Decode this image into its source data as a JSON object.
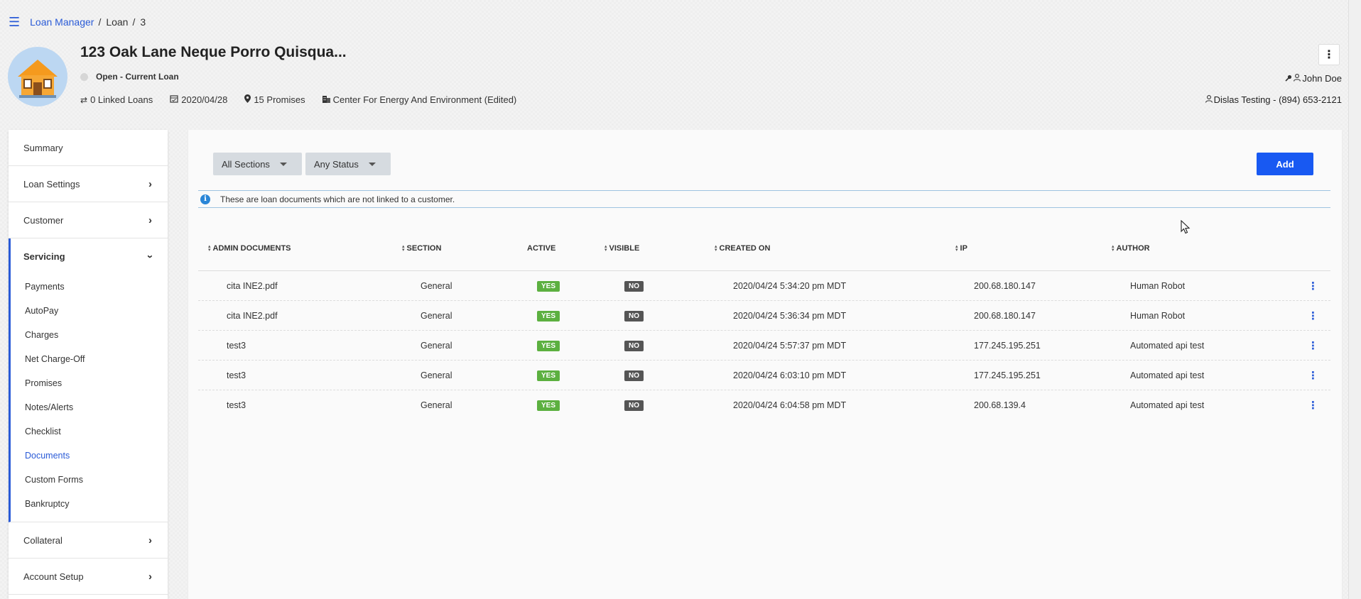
{
  "breadcrumb": {
    "root": "Loan Manager",
    "section": "Loan",
    "id": "3"
  },
  "loan": {
    "title": "123 Oak Lane Neque Porro Quisqua...",
    "status": "Open - Current Loan",
    "linked_loans": "0 Linked Loans",
    "date": "2020/04/28",
    "promises": "15 Promises",
    "company": "Center For Energy And Environment (Edited)",
    "owner": "John Doe",
    "contact": "Dislas Testing - (894) 653-2121"
  },
  "sidebar": {
    "sections": [
      {
        "label": "Summary"
      },
      {
        "label": "Loan Settings"
      },
      {
        "label": "Customer"
      }
    ],
    "servicing": {
      "label": "Servicing",
      "items": [
        {
          "label": "Payments"
        },
        {
          "label": "AutoPay"
        },
        {
          "label": "Charges"
        },
        {
          "label": "Net Charge-Off"
        },
        {
          "label": "Promises"
        },
        {
          "label": "Notes/Alerts"
        },
        {
          "label": "Checklist"
        },
        {
          "label": "Documents"
        },
        {
          "label": "Custom Forms"
        },
        {
          "label": "Bankruptcy"
        }
      ]
    },
    "after": [
      {
        "label": "Collateral"
      },
      {
        "label": "Account Setup"
      }
    ]
  },
  "filters": {
    "section": "All Sections",
    "status": "Any Status"
  },
  "add_label": "Add",
  "info_text": "These are loan documents which are not linked to a customer.",
  "table": {
    "headers": {
      "doc": "ADMIN DOCUMENTS",
      "section": "SECTION",
      "active": "ACTIVE",
      "visible": "VISIBLE",
      "created": "CREATED ON",
      "ip": "IP",
      "author": "AUTHOR"
    },
    "rows": [
      {
        "doc": "cita INE2.pdf",
        "section": "General",
        "active": "YES",
        "visible": "NO",
        "created": "2020/04/24 5:34:20 pm MDT",
        "ip": "200.68.180.147",
        "author": "Human Robot"
      },
      {
        "doc": "cita INE2.pdf",
        "section": "General",
        "active": "YES",
        "visible": "NO",
        "created": "2020/04/24 5:36:34 pm MDT",
        "ip": "200.68.180.147",
        "author": "Human Robot"
      },
      {
        "doc": "test3",
        "section": "General",
        "active": "YES",
        "visible": "NO",
        "created": "2020/04/24 5:57:37 pm MDT",
        "ip": "177.245.195.251",
        "author": "Automated api test"
      },
      {
        "doc": "test3",
        "section": "General",
        "active": "YES",
        "visible": "NO",
        "created": "2020/04/24 6:03:10 pm MDT",
        "ip": "177.245.195.251",
        "author": "Automated api test"
      },
      {
        "doc": "test3",
        "section": "General",
        "active": "YES",
        "visible": "NO",
        "created": "2020/04/24 6:04:58 pm MDT",
        "ip": "200.68.139.4",
        "author": "Automated api test"
      }
    ]
  },
  "colors": {
    "accent": "#2a5bd7",
    "button": "#1859f2",
    "yes": "#5cb040",
    "no": "#555555"
  }
}
